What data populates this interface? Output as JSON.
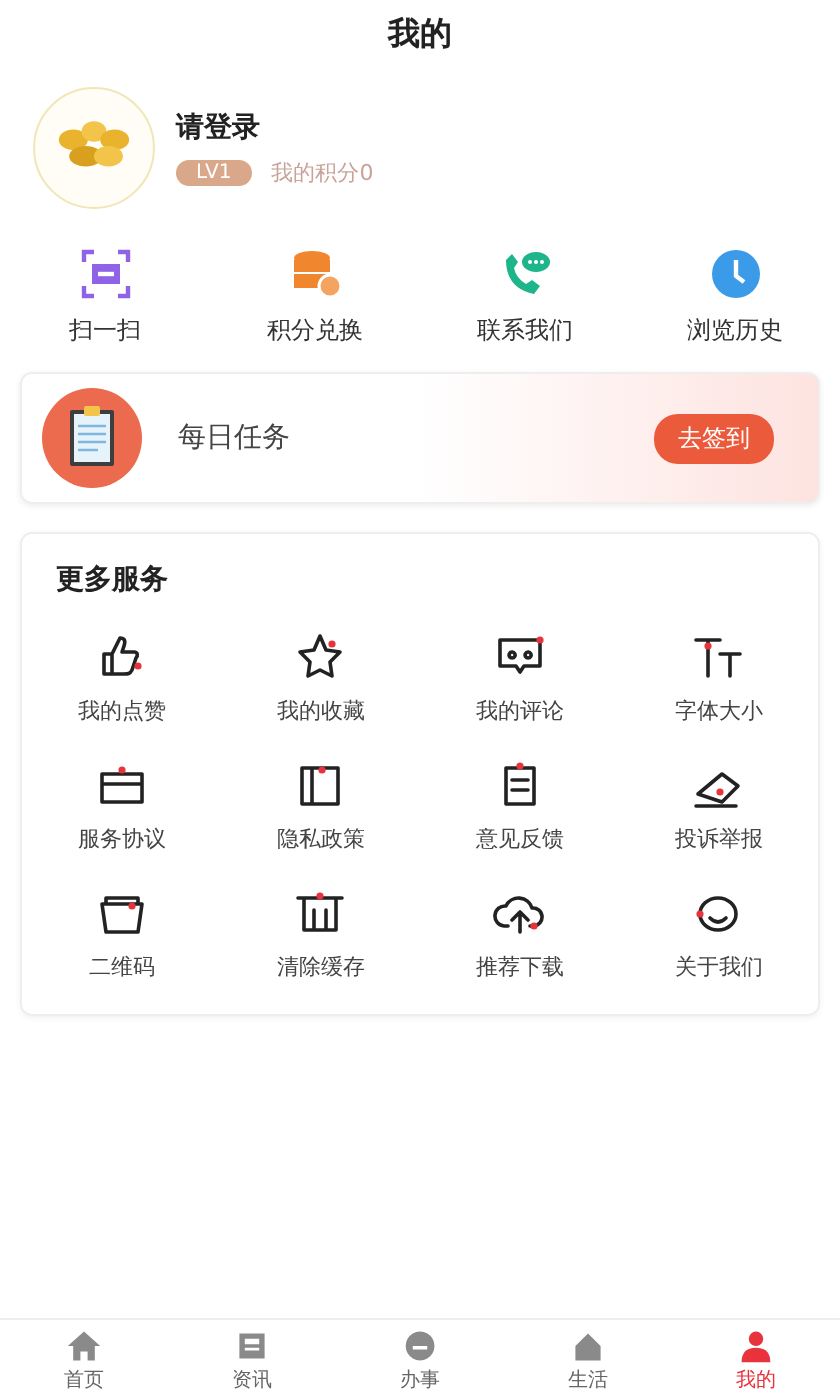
{
  "header": {
    "title": "我的"
  },
  "profile": {
    "name": "请登录",
    "level": "LV1",
    "points": "我的积分0"
  },
  "shortcuts": [
    {
      "label": "扫一扫"
    },
    {
      "label": "积分兑换"
    },
    {
      "label": "联系我们"
    },
    {
      "label": "浏览历史"
    }
  ],
  "daily_task": {
    "title": "每日任务",
    "button": "去签到"
  },
  "more_services": {
    "title": "更多服务",
    "items": [
      {
        "label": "我的点赞"
      },
      {
        "label": "我的收藏"
      },
      {
        "label": "我的评论"
      },
      {
        "label": "字体大小"
      },
      {
        "label": "服务协议"
      },
      {
        "label": "隐私政策"
      },
      {
        "label": "意见反馈"
      },
      {
        "label": "投诉举报"
      },
      {
        "label": "二维码"
      },
      {
        "label": "清除缓存"
      },
      {
        "label": "推荐下载"
      },
      {
        "label": "关于我们"
      }
    ]
  },
  "tab_bar": [
    {
      "label": "首页",
      "selected": false
    },
    {
      "label": "资讯",
      "selected": false
    },
    {
      "label": "办事",
      "selected": false
    },
    {
      "label": "生活",
      "selected": false
    },
    {
      "label": "我的",
      "selected": true
    }
  ]
}
